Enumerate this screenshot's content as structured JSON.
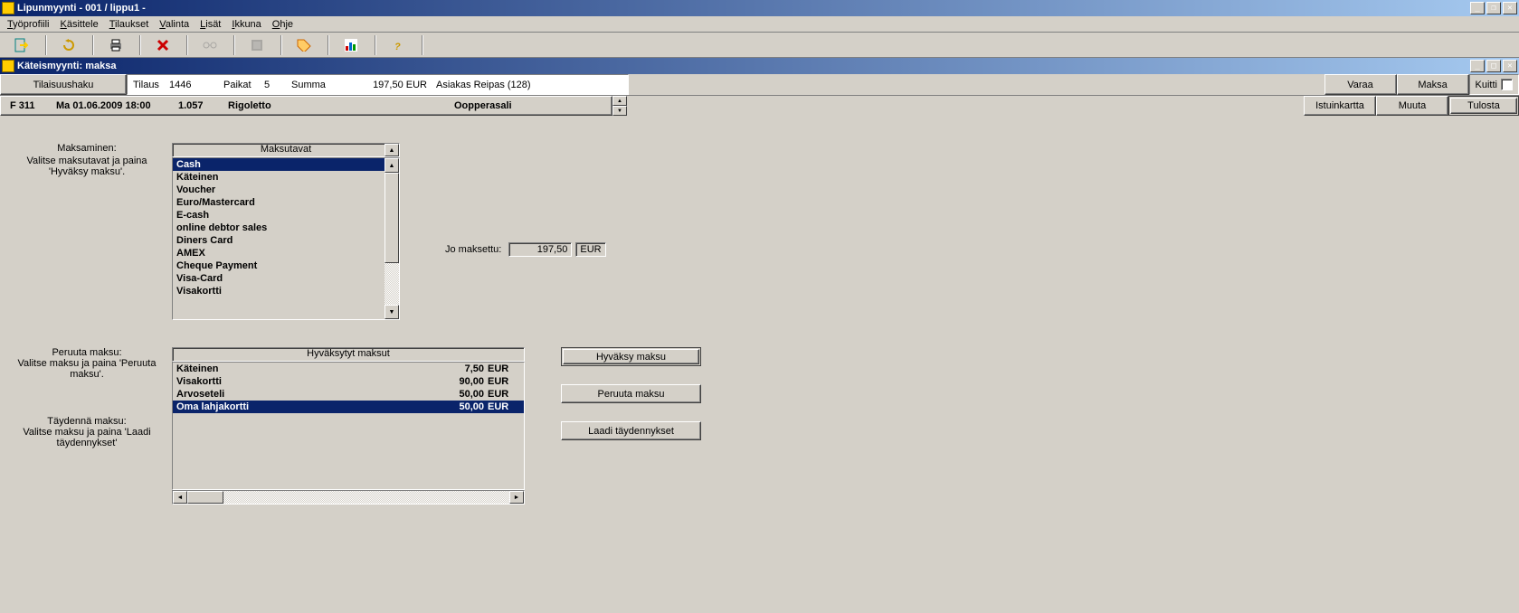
{
  "app_title": "Lipunmyynti  - 001 / lippu1 -",
  "menu": [
    "Työprofiili",
    "Käsittele",
    "Tilaukset",
    "Valinta",
    "Lisät",
    "Ikkuna",
    "Ohje"
  ],
  "inner_title": "Käteismyynti: maksa",
  "row1": {
    "search_btn": "Tilaisuushaku",
    "tilaus_lbl": "Tilaus",
    "tilaus_val": "1446",
    "paikat_lbl": "Paikat",
    "paikat_val": "5",
    "summa_lbl": "Summa",
    "summa_val": "197,50 EUR",
    "asiakas": "Asiakas Reipas (128)",
    "varaa": "Varaa",
    "maksa": "Maksa",
    "kuitti": "Kuitti"
  },
  "row2": {
    "code": "F 311",
    "date": "Ma 01.06.2009 18:00",
    "num": "1.057",
    "show": "Rigoletto",
    "venue": "Oopperasali",
    "istuin": "Istuinkartta",
    "muuta": "Muuta",
    "tulosta": "Tulosta"
  },
  "section1": {
    "label_title": "Maksaminen:",
    "label_help": "Valitse maksutavat ja paina 'Hyväksy maksu'.",
    "list_header": "Maksutavat",
    "items": [
      "Cash",
      "Käteinen",
      "Voucher",
      "Euro/Mastercard",
      "E-cash",
      "online debtor sales",
      "Diners Card",
      "AMEX",
      "Cheque Payment",
      "Visa-Card",
      "Visakortti"
    ],
    "selected_index": 0,
    "paid_label": "Jo maksettu:",
    "paid_value": "197,50",
    "paid_currency": "EUR"
  },
  "section2": {
    "cancel_title": "Peruuta maksu:",
    "cancel_help": "Valitse maksu ja paina 'Peruuta maksu'.",
    "complete_title": "Täydennä maksu:",
    "complete_help": "Valitse maksu ja paina 'Laadi täydennykset'",
    "list_header": "Hyväksytyt maksut",
    "payments": [
      {
        "name": "Käteinen",
        "amount": "7,50",
        "unit": "EUR"
      },
      {
        "name": "Visakortti",
        "amount": "90,00",
        "unit": "EUR"
      },
      {
        "name": "Arvoseteli",
        "amount": "50,00",
        "unit": "EUR"
      },
      {
        "name": "Oma lahjakortti",
        "amount": "50,00",
        "unit": "EUR"
      }
    ],
    "selected_index": 3,
    "btn_accept": "Hyväksy maksu",
    "btn_cancel": "Peruuta maksu",
    "btn_complete": "Laadi täydennykset"
  }
}
